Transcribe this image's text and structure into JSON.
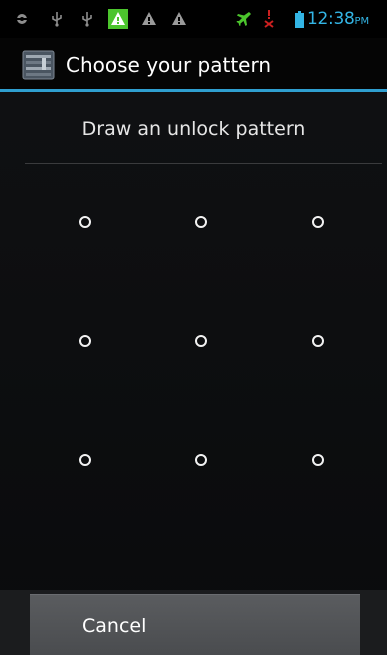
{
  "status_bar": {
    "icons": [
      "android-debug-icon",
      "usb-icon",
      "usb-icon",
      "alert-icon",
      "warning-icon",
      "warning-icon",
      "airplane-icon",
      "sim-error-icon",
      "battery-icon"
    ],
    "time": "12:38",
    "ampm": "PM",
    "clock_color": "#33b5e5"
  },
  "title_bar": {
    "title": "Choose your pattern",
    "accent_color": "#2f9fd0"
  },
  "header": {
    "text": "Draw an unlock pattern"
  },
  "pattern": {
    "rows": 3,
    "cols": 3
  },
  "bottom": {
    "cancel_label": "Cancel"
  }
}
